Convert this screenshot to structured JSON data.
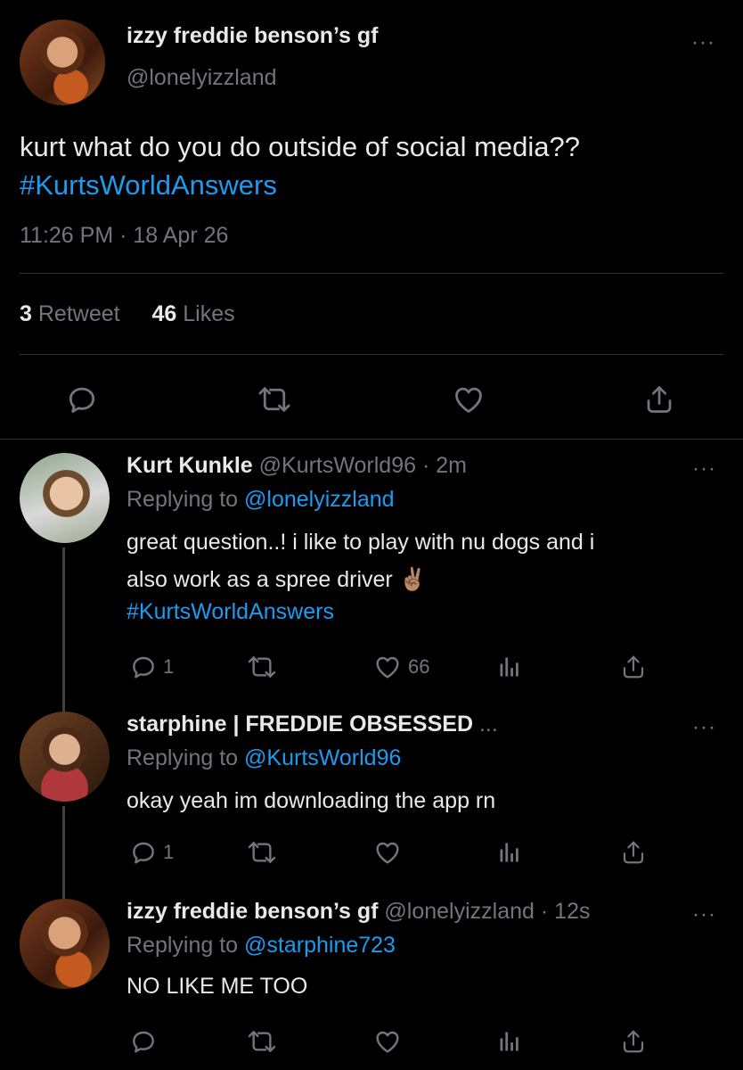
{
  "main_tweet": {
    "author_name": "izzy freddie benson’s gf",
    "author_handle": "@lonelyizzland",
    "more": "···",
    "text_plain": "kurt what do you do outside of social media??",
    "hashtag": "#KurtsWorldAnswers",
    "timestamp": "11:26 PM · 18 Apr 26",
    "retweet_count": "3",
    "retweet_label": "Retweet",
    "like_count": "46",
    "like_label": "Likes",
    "actions": [
      "reply-icon",
      "retweet-icon",
      "like-icon",
      "share-icon"
    ]
  },
  "replies": [
    {
      "name": "Kurt Kunkle",
      "handle": "@KurtsWorld96",
      "time": "· 2m",
      "replying_prefix": "Replying to",
      "replying_to": "@lonelyizzland",
      "body_line1": "great question..! i like to play with nu dogs and i",
      "body_line2": "also work as a spree driver ✌🏽",
      "hashtag": "#KurtsWorldAnswers",
      "reply_count": "1",
      "like_count": "66",
      "more": "···"
    },
    {
      "name": "starphine | FREDDIE OBSESSED",
      "name_ellipsis": "...",
      "replying_prefix": "Replying to",
      "replying_to": "@KurtsWorld96",
      "body_line1": "okay yeah im downloading the app rn",
      "reply_count": "1",
      "more": "···"
    },
    {
      "name": "izzy freddie benson’s gf",
      "handle": "@lonelyizzland",
      "time": "· 12s",
      "replying_prefix": "Replying to",
      "replying_to": "@starphine723",
      "body_line1": "NO LIKE ME TOO",
      "more": "···"
    }
  ],
  "colors": {
    "background": "#000000",
    "text": "#e7e9ea",
    "muted": "#71767b",
    "link": "#1d9bf0",
    "divider": "#2f3336"
  }
}
